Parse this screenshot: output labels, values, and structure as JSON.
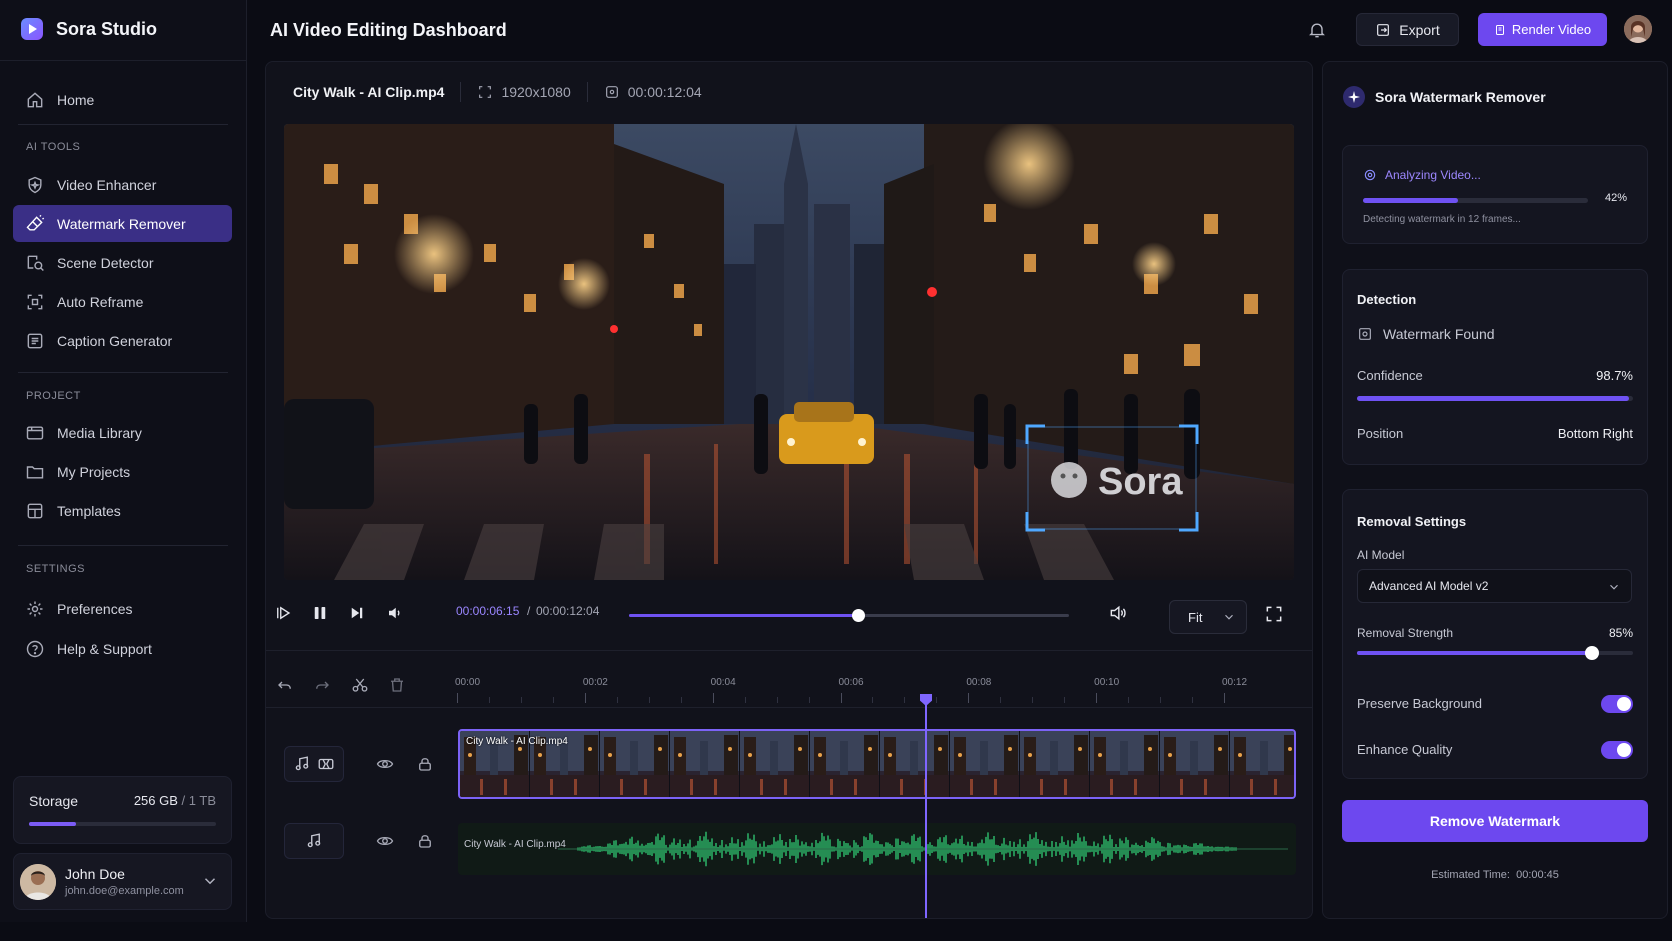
{
  "app": {
    "name": "Sora Studio"
  },
  "header": {
    "title": "AI Video Editing Dashboard",
    "export_label": "Export",
    "render_label": "Render Video"
  },
  "sidebar": {
    "home": "Home",
    "ai_tools_label": "AI TOOLS",
    "ai_tools": [
      "Video Enhancer",
      "Watermark Remover",
      "Scene Detector",
      "Auto Reframe",
      "Caption Generator"
    ],
    "active_item": "Watermark Remover",
    "project_label": "PROJECT",
    "project": [
      "Media Library",
      "My Projects",
      "Templates"
    ],
    "settings_label": "SETTINGS",
    "settings": [
      "Preferences",
      "Help & Support"
    ]
  },
  "storage": {
    "label": "Storage",
    "used": "256 GB",
    "total": "/ 1 TB",
    "fraction": 0.25
  },
  "user": {
    "name": "John Doe",
    "email": "john.doe@example.com"
  },
  "editor": {
    "file_name": "City Walk - AI Clip.mp4",
    "resolution": "1920x1080",
    "duration": "00:00:12:04",
    "current_time": "00:00:06:15",
    "time_separator": "/",
    "total_time": "00:00:12:04",
    "progress": 0.52,
    "fit_label": "Fit",
    "watermark_text": "Sora",
    "ruler_labels": [
      "00:00",
      "00:02",
      "00:04",
      "00:06",
      "00:08",
      "00:10",
      "00:12"
    ],
    "video_clip_label": "City Walk - AI Clip.mp4",
    "audio_clip_label": "City Walk - AI Clip.mp4",
    "accent": "#6d48ef"
  },
  "panel": {
    "title": "Sora Watermark Remover",
    "analysis": {
      "title": "Analyzing Video...",
      "percent": "42%",
      "fraction": 0.42,
      "note": "Detecting watermark in 12 frames..."
    },
    "detection": {
      "title": "Detection",
      "status": "Watermark Found",
      "confidence_label": "Confidence",
      "confidence_value": "98.7%",
      "confidence_fraction": 0.987,
      "position_label": "Position",
      "position_value": "Bottom Right"
    },
    "settings": {
      "title": "Removal Settings",
      "model_label": "AI Model",
      "model_value": "Advanced AI Model v2",
      "strength_label": "Removal Strength",
      "strength_value": "85%",
      "strength_fraction": 0.85,
      "preserve_label": "Preserve Background",
      "preserve_on": true,
      "enhance_label": "Enhance Quality",
      "enhance_on": true
    },
    "remove_button": "Remove Watermark",
    "estimated_label": "Estimated Time:",
    "estimated_value": "00:00:45"
  }
}
